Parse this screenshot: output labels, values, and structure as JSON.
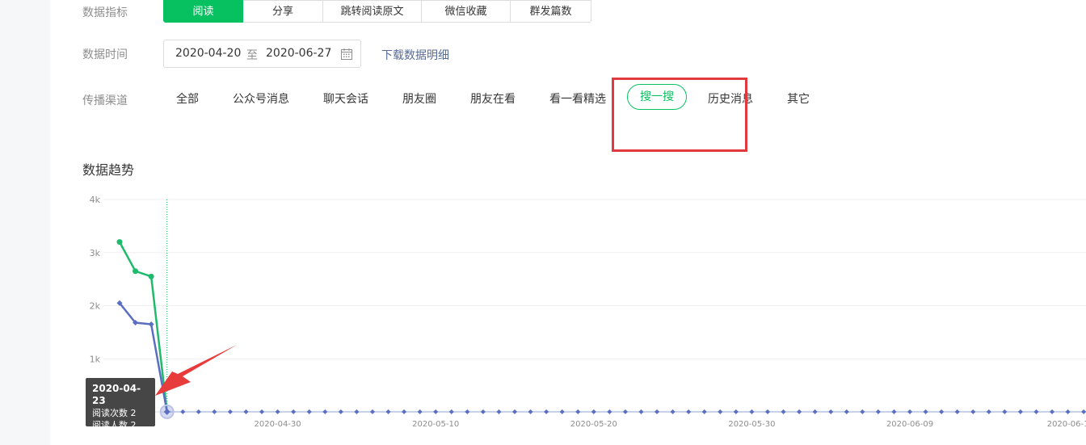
{
  "metrics": {
    "label": "数据指标",
    "tabs": [
      {
        "label": "阅读",
        "active": true
      },
      {
        "label": "分享",
        "active": false
      },
      {
        "label": "跳转阅读原文",
        "active": false
      },
      {
        "label": "微信收藏",
        "active": false
      },
      {
        "label": "群发篇数",
        "active": false
      }
    ]
  },
  "time": {
    "label": "数据时间",
    "start": "2020-04-20",
    "separator": "至",
    "end": "2020-06-27",
    "calendar_icon": "calendar-icon",
    "download_label": "下载数据明细"
  },
  "channels": {
    "label": "传播渠道",
    "items": [
      {
        "label": "全部",
        "active": false
      },
      {
        "label": "公众号消息",
        "active": false
      },
      {
        "label": "聊天会话",
        "active": false
      },
      {
        "label": "朋友圈",
        "active": false
      },
      {
        "label": "朋友在看",
        "active": false
      },
      {
        "label": "看一看精选",
        "active": false
      },
      {
        "label": "搜一搜",
        "active": true
      },
      {
        "label": "历史消息",
        "active": false
      },
      {
        "label": "其它",
        "active": false
      }
    ]
  },
  "trend": {
    "title": "数据趋势"
  },
  "tooltip": {
    "date": "2020-04-23",
    "reads": "阅读次数 2",
    "readers": "阅读人数 2"
  },
  "colors": {
    "accent": "#07c160",
    "link": "#576b95",
    "series_blue": "#5b6fc2",
    "series_green": "#1fba6b",
    "annotation_red": "#e0393e"
  },
  "chart_data": {
    "type": "line",
    "ylim": [
      0,
      4000
    ],
    "yticks": [
      "4k",
      "3k",
      "2k",
      "1k"
    ],
    "xticks": [
      "2020-04-30",
      "2020-05-10",
      "2020-05-20",
      "2020-05-30",
      "2020-06-09",
      "2020-06-1"
    ],
    "x_start": "2020-04-20",
    "x_end_visible": "2020-06-11",
    "series": [
      {
        "color": "#1fba6b",
        "values": [
          3200,
          2650,
          2550,
          2
        ]
      },
      {
        "color": "#5b6fc2",
        "values": [
          2050,
          1680,
          1650,
          2
        ]
      }
    ],
    "grid": true,
    "hover_date": "2020-04-23"
  }
}
